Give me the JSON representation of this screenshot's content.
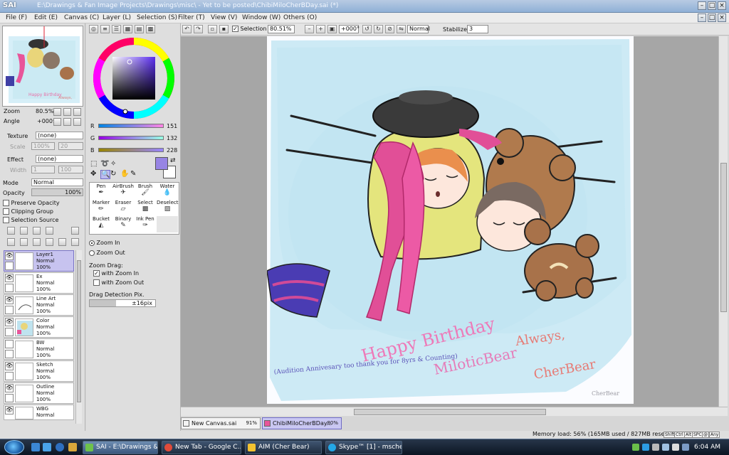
{
  "window": {
    "app_logo": "SAI",
    "title_path": "E:\\Drawings & Fan Image Projects\\Drawings\\misc\\ - Yet to be posted\\ChibiMiloCherBDay.sai (*)"
  },
  "menu": [
    "File (F)",
    "Edit (E)",
    "Canvas (C)",
    "Layer (L)",
    "Selection (S)",
    "Filter (T)",
    "View (V)",
    "Window (W)",
    "Others (O)"
  ],
  "canvas_toolbar": {
    "selection_label": "Selection",
    "zoom": "80.51%",
    "angle": "+000°",
    "mode": "Normal",
    "stabilizer_label": "Stabilizer",
    "stabilizer_value": "3"
  },
  "navigator": {
    "zoom_label": "Zoom",
    "zoom_value": "80.5%",
    "angle_label": "Angle",
    "angle_value": "+000$"
  },
  "paper": {
    "texture_label": "Texture",
    "texture_value": "(none)",
    "scale_label": "Scale",
    "scale_value": "100%",
    "scale_num": "20",
    "effect_label": "Effect",
    "effect_value": "(none)",
    "width_label": "Width",
    "width_value": "1",
    "width_num": "100"
  },
  "layer_props": {
    "mode_label": "Mode",
    "mode_value": "Normal",
    "opacity_label": "Opacity",
    "opacity_value": "100%",
    "preserve_opacity": "Preserve Opacity",
    "clipping_group": "Clipping Group",
    "selection_source": "Selection Source"
  },
  "layers": [
    {
      "name": "Layer1",
      "mode": "Normal",
      "opacity": "100%",
      "selected": true
    },
    {
      "name": "Ex",
      "mode": "Normal",
      "opacity": "100%",
      "selected": false
    },
    {
      "name": "Line Art",
      "mode": "Normal",
      "opacity": "100%",
      "selected": false
    },
    {
      "name": "Color",
      "mode": "Normal",
      "opacity": "100%",
      "selected": false
    },
    {
      "name": "BW",
      "mode": "Normal",
      "opacity": "100%",
      "selected": false
    },
    {
      "name": "Sketch",
      "mode": "Normal",
      "opacity": "100%",
      "selected": false
    },
    {
      "name": "Outline",
      "mode": "Normal",
      "opacity": "100%",
      "selected": false
    },
    {
      "name": "WBG",
      "mode": "Normal",
      "opacity": "",
      "selected": false
    }
  ],
  "color": {
    "r_label": "R",
    "r_value": "151",
    "g_label": "G",
    "g_value": "132",
    "b_label": "B",
    "b_value": "228",
    "current": "#9784e4"
  },
  "tools": [
    {
      "label": "Pen"
    },
    {
      "label": "AirBrush"
    },
    {
      "label": "Brush"
    },
    {
      "label": "Water"
    },
    {
      "label": "Marker"
    },
    {
      "label": "Eraser"
    },
    {
      "label": "Select"
    },
    {
      "label": "Deselect"
    },
    {
      "label": "Bucket"
    },
    {
      "label": "Binary"
    },
    {
      "label": "Ink Pen"
    },
    {
      "label": ""
    }
  ],
  "zoom_tool": {
    "zoom_in": "Zoom In",
    "zoom_out": "Zoom Out",
    "drag_label": "Zoom Drag:",
    "with_zoom_in": "with Zoom In",
    "with_zoom_out": "with Zoom Out",
    "detection_label": "Drag Detection Pix.",
    "detection_value": "±16pix"
  },
  "artwork_text": {
    "line1": "Happy Birthday",
    "line2": "MiloticBear",
    "note": "(Audition Annivesary too thank you for 8yrs & Counting)",
    "sign1": "Always,",
    "sign2": "CherBear",
    "watermark": "CherBear"
  },
  "doc_tabs": [
    {
      "name": "New Canvas.sai",
      "zoom": "91%",
      "active": false
    },
    {
      "name": "ChibiMiloCherBDay...",
      "zoom": "80%",
      "active": true
    }
  ],
  "status": {
    "memory": "Memory load: 56% (165MB used / 827MB reserved)",
    "keys": [
      "Shift",
      "Ctrl",
      "Alt",
      "SPC",
      "@",
      "Any"
    ]
  },
  "taskbar": {
    "tasks": [
      {
        "label": "SAI - E:\\Drawings & ...",
        "active": true
      },
      {
        "label": "New Tab - Google C...",
        "active": false
      },
      {
        "label": "AIM (Cher Bear)",
        "active": false
      },
      {
        "label": "Skype™ [1] - mscher...",
        "active": false
      }
    ],
    "clock": "6:04 AM"
  }
}
